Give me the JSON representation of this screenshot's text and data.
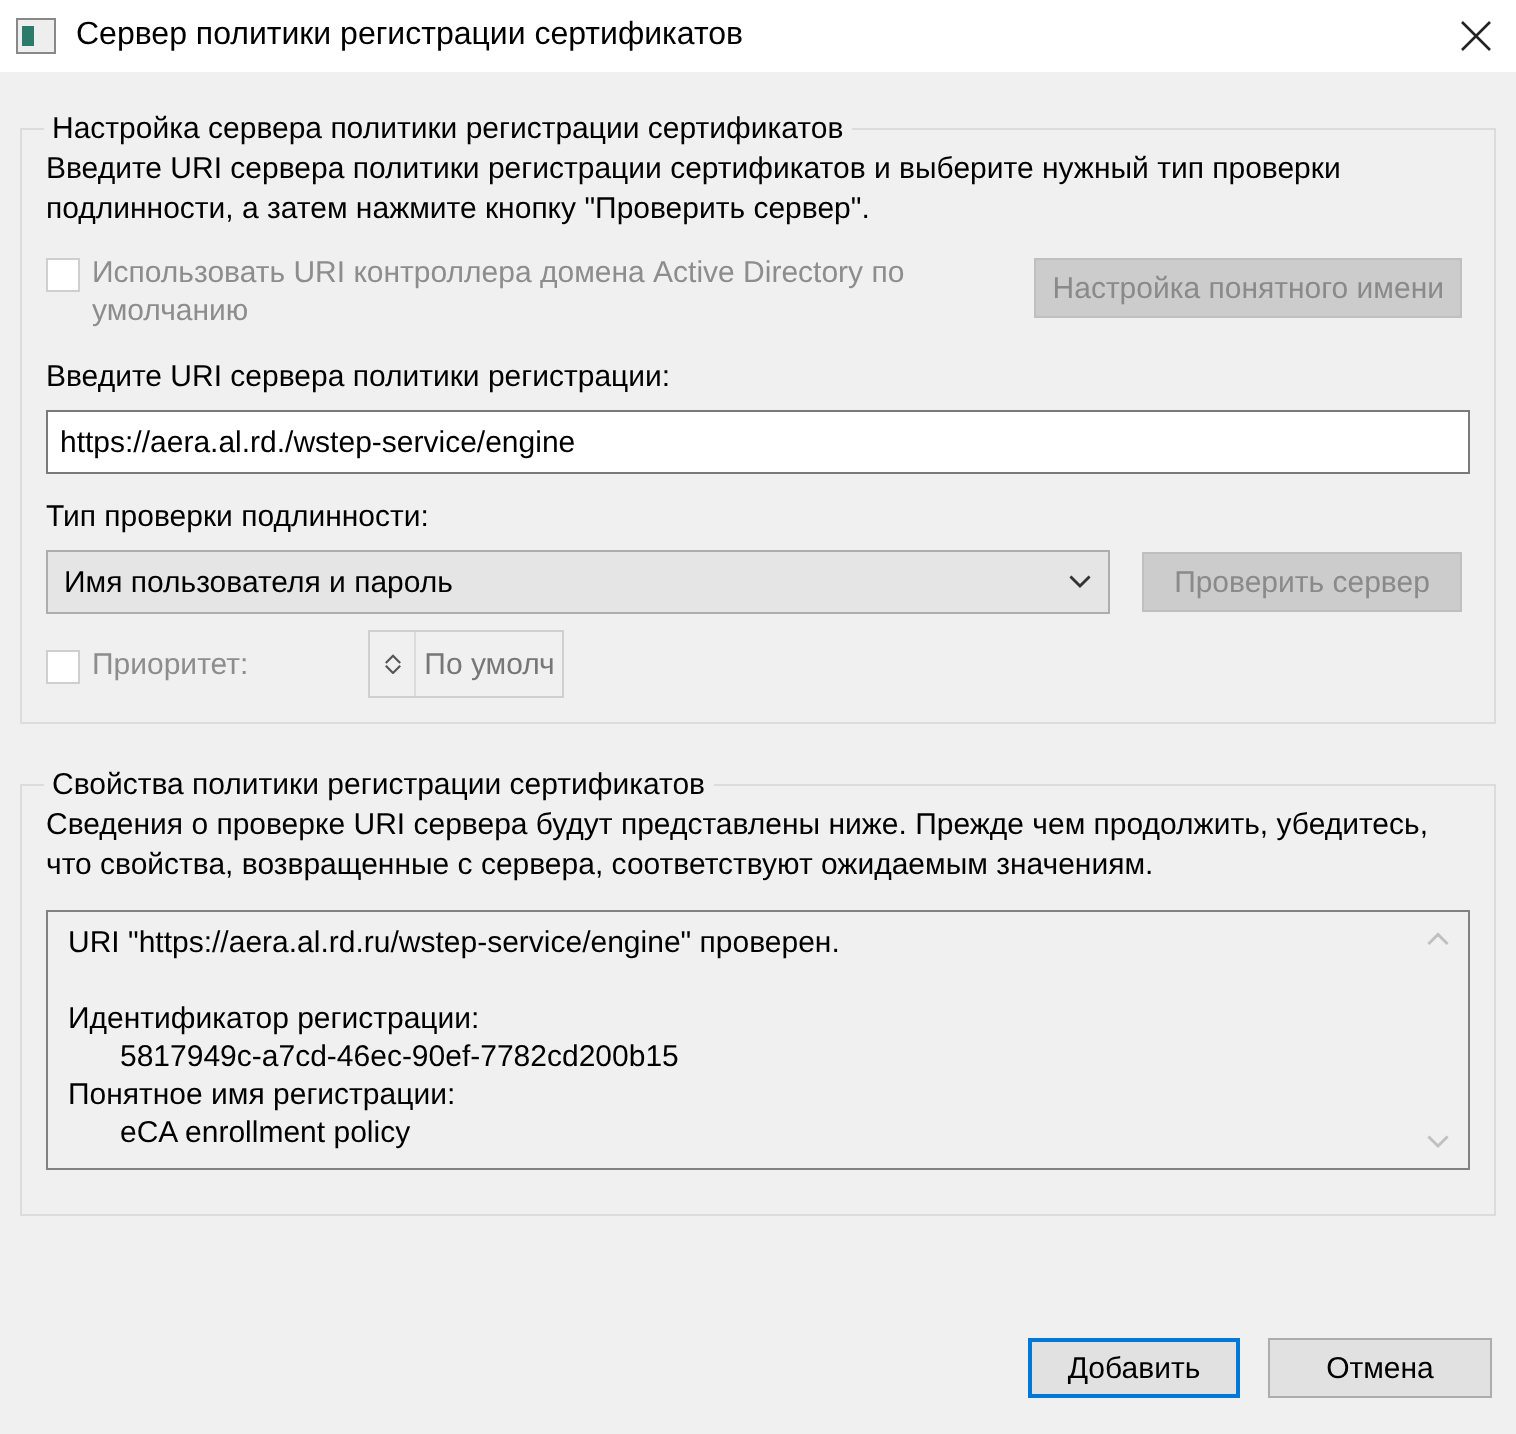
{
  "window": {
    "title": "Сервер политики регистрации сертификатов"
  },
  "settings_group": {
    "title": "Настройка сервера политики регистрации сертификатов",
    "instructions": "Введите URI сервера политики регистрации сертификатов и выберите нужный тип проверки подлинности, а затем нажмите кнопку \"Проверить сервер\".",
    "ad_checkbox": {
      "label": "Использовать URI контроллера домена Active Directory по умолчанию",
      "checked": false,
      "disabled": true
    },
    "friendly_name_button": {
      "label": "Настройка понятного имени",
      "disabled": true
    },
    "uri_label": "Введите URI сервера политики регистрации:",
    "uri_field": {
      "value": "https://aera.al.rd./wstep-service/engine"
    },
    "auth_label": "Тип проверки подлинности:",
    "auth_select": {
      "value": "Имя пользователя и пароль"
    },
    "check_button": {
      "label": "Проверить сервер",
      "disabled": true
    },
    "priority_checkbox": {
      "label": "Приоритет:",
      "checked": false,
      "disabled": true
    },
    "priority_spinner": {
      "value": "По умолч",
      "disabled": true
    }
  },
  "properties_group": {
    "title": "Свойства политики регистрации сертификатов",
    "description": "Сведения о проверке URI сервера будут представлены ниже. Прежде чем продолжить, убедитесь, что свойства, возвращенные с сервера, соответствуют ожидаемым значениям.",
    "details": [
      {
        "text": "URI \"https://aera.al.rd.ru/wstep-service/engine\" проверен."
      },
      {
        "text": "Идентификатор регистрации:",
        "children": [
          {
            "text": "5817949c-a7cd-46ec-90ef-7782cd200b15"
          }
        ]
      },
      {
        "text": "Понятное имя регистрации:",
        "children": [
          {
            "text": "eCA enrollment policy"
          }
        ]
      }
    ]
  },
  "buttons": [
    {
      "label": "Добавить",
      "default": true
    },
    {
      "label": "Отмена",
      "default": false
    }
  ]
}
